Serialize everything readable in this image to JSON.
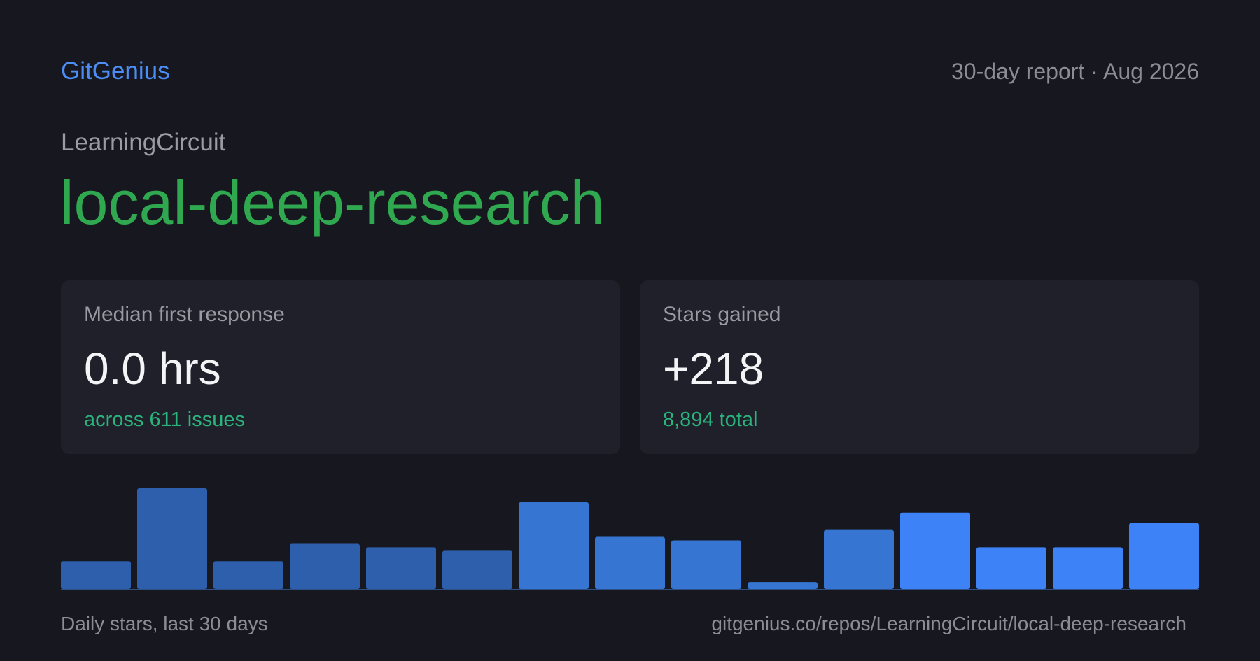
{
  "header": {
    "brand": "GitGenius",
    "report": "30-day report · Aug 2026"
  },
  "repo": {
    "owner": "LearningCircuit",
    "name": "local-deep-research"
  },
  "cards": [
    {
      "label": "Median first response",
      "value": "0.0 hrs",
      "sub": "across 611 issues"
    },
    {
      "label": "Stars gained",
      "value": "+218",
      "sub": "8,894 total"
    }
  ],
  "chart_data": {
    "type": "bar",
    "values": [
      8,
      29,
      8,
      13,
      12,
      11,
      25,
      15,
      14,
      2,
      17,
      22,
      12,
      12,
      19
    ],
    "colors": [
      "#2d5fac",
      "#2d5fac",
      "#2d5fac",
      "#2d5fac",
      "#2d5fac",
      "#2d5fac",
      "#3676d2",
      "#3676d2",
      "#3676d2",
      "#3676d2",
      "#3676d2",
      "#3d82f7",
      "#3d82f7",
      "#3d82f7",
      "#3d82f7"
    ],
    "baseline_color": "#2d4f86"
  },
  "footer": {
    "caption": "Daily stars, last 30 days",
    "url": "gitgenius.co/repos/LearningCircuit/local-deep-research"
  }
}
